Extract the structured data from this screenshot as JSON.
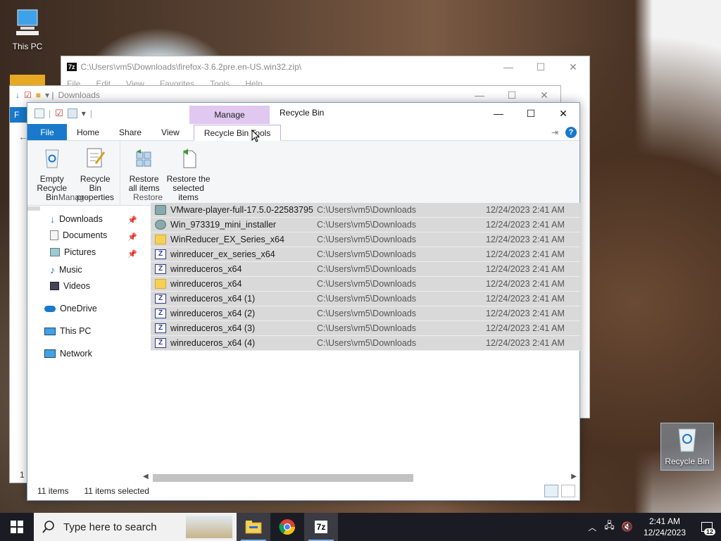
{
  "desktop": {
    "this_pc_label": "This PC",
    "recycle_bin_label": "Recycle Bin"
  },
  "bg_7zip": {
    "title": "C:\\Users\\vm5\\Downloads\\firefox-3.6.2pre.en-US.win32.zip\\",
    "menu": [
      "File",
      "Edit",
      "View",
      "Favorites",
      "Tools",
      "Help"
    ]
  },
  "bg_downloads": {
    "title": "Downloads",
    "status_fragment": "1 i"
  },
  "window": {
    "title": "Recycle Bin",
    "context_tab_group": "Manage",
    "tabs": {
      "file": "File",
      "home": "Home",
      "share": "Share",
      "view": "View",
      "context": "Recycle Bin Tools"
    },
    "help": "?"
  },
  "ribbon": {
    "manage_group": "Manage",
    "restore_group": "Restore",
    "empty_bin": [
      "Empty",
      "Recycle Bin"
    ],
    "bin_props": [
      "Recycle Bin",
      "properties"
    ],
    "restore_all": [
      "Restore",
      "all items"
    ],
    "restore_selected": [
      "Restore the",
      "selected items"
    ]
  },
  "nav": {
    "downloads": "Downloads",
    "documents": "Documents",
    "pictures": "Pictures",
    "music": "Music",
    "videos": "Videos",
    "onedrive": "OneDrive",
    "thispc": "This PC",
    "network": "Network"
  },
  "files": [
    {
      "name": "VMware-player-full-17.5.0-22583795",
      "location": "C:\\Users\\vm5\\Downloads",
      "date": "12/24/2023 2:41 AM",
      "icon": "vmware-installer-icon"
    },
    {
      "name": "Win_973319_mini_installer",
      "location": "C:\\Users\\vm5\\Downloads",
      "date": "12/24/2023 2:41 AM",
      "icon": "installer-icon"
    },
    {
      "name": "WinReducer_EX_Series_x64",
      "location": "C:\\Users\\vm5\\Downloads",
      "date": "12/24/2023 2:41 AM",
      "icon": "folder-icon"
    },
    {
      "name": "winreducer_ex_series_x64",
      "location": "C:\\Users\\vm5\\Downloads",
      "date": "12/24/2023 2:41 AM",
      "icon": "zip-icon"
    },
    {
      "name": "winreduceros_x64",
      "location": "C:\\Users\\vm5\\Downloads",
      "date": "12/24/2023 2:41 AM",
      "icon": "zip-icon"
    },
    {
      "name": "winreduceros_x64",
      "location": "C:\\Users\\vm5\\Downloads",
      "date": "12/24/2023 2:41 AM",
      "icon": "folder-icon"
    },
    {
      "name": "winreduceros_x64 (1)",
      "location": "C:\\Users\\vm5\\Downloads",
      "date": "12/24/2023 2:41 AM",
      "icon": "zip-icon"
    },
    {
      "name": "winreduceros_x64 (2)",
      "location": "C:\\Users\\vm5\\Downloads",
      "date": "12/24/2023 2:41 AM",
      "icon": "zip-icon"
    },
    {
      "name": "winreduceros_x64 (3)",
      "location": "C:\\Users\\vm5\\Downloads",
      "date": "12/24/2023 2:41 AM",
      "icon": "zip-icon"
    },
    {
      "name": "winreduceros_x64 (4)",
      "location": "C:\\Users\\vm5\\Downloads",
      "date": "12/24/2023 2:41 AM",
      "icon": "zip-icon"
    }
  ],
  "status": {
    "count": "11 items",
    "selected": "11 items selected"
  },
  "taskbar": {
    "search_placeholder": "Type here to search",
    "time": "2:41 AM",
    "date": "12/24/2023",
    "notification_count": "12"
  },
  "colors": {
    "accent": "#1979ca",
    "context_tab": "#e0c8f0",
    "selection": "#d9d9d9"
  }
}
